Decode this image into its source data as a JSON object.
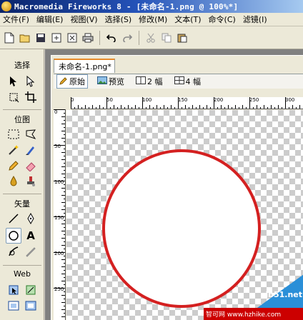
{
  "window": {
    "title": "Macromedia Fireworks 8 - [未命名-1.png @ 100%*]"
  },
  "menu": [
    "文件(F)",
    "编辑(E)",
    "视图(V)",
    "选择(S)",
    "修改(M)",
    "文本(T)",
    "命令(C)",
    "滤镜(I)"
  ],
  "toolbar": {
    "icons": [
      "new-file-icon",
      "open-icon",
      "save-icon",
      "import-icon",
      "export-icon",
      "print-icon",
      "undo-icon",
      "redo-icon",
      "cut-icon",
      "copy-icon",
      "paste-icon"
    ]
  },
  "tools_panel": {
    "select_label": "选择",
    "bitmap_label": "位图",
    "vector_label": "矢量",
    "web_label": "Web",
    "selected_tool": "ellipse-tool"
  },
  "document": {
    "tab_label": "未命名-1.png*",
    "views": [
      {
        "label": "原始",
        "icon": "pencil-icon",
        "active": true
      },
      {
        "label": "预览",
        "icon": "picture-icon",
        "active": false
      },
      {
        "label": "2 幅",
        "icon": "two-up-icon",
        "active": false
      },
      {
        "label": "4 幅",
        "icon": "four-up-icon",
        "active": false
      }
    ],
    "ruler_h_labels": [
      "0",
      "50",
      "100",
      "150",
      "200",
      "250",
      "300"
    ],
    "ruler_v_labels": [
      "0",
      "50",
      "100",
      "150",
      "200",
      "250"
    ],
    "circle_stroke_color": "#d42020"
  },
  "watermark": {
    "text1": "jb51.net",
    "text2": "智可网 www.hzhike.com"
  }
}
